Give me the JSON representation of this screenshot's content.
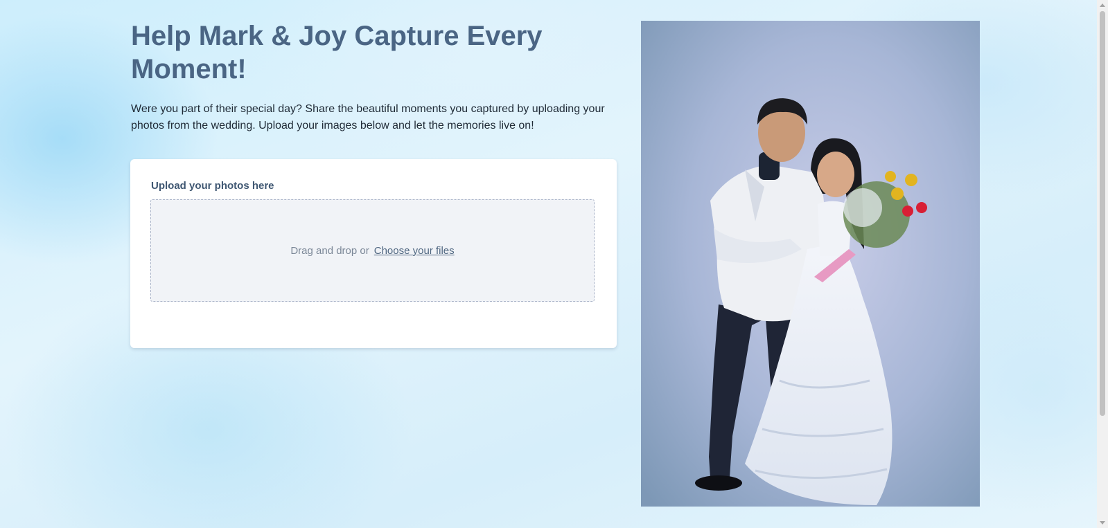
{
  "hero": {
    "title": "Help Mark & Joy Capture Every Moment!",
    "description": "Were you part of their special day? Share the beautiful moments you captured by uploading your photos from the wedding. Upload your images below and let the memories live on!"
  },
  "upload": {
    "label": "Upload your photos here",
    "drop_text": "Drag and drop or",
    "choose_link": "Choose your files"
  },
  "colors": {
    "heading": "#4a6584",
    "link": "#4f6680",
    "dropzone_bg": "#f1f3f7",
    "photo_backdrop": "#a9b9d6"
  }
}
